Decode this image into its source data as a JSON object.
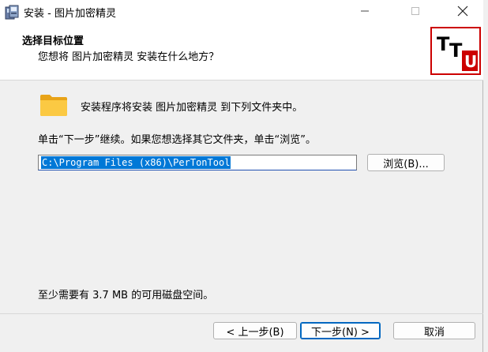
{
  "window": {
    "title": "安装 - 图片加密精灵",
    "min_glyph": "—",
    "max_glyph": "☐",
    "close_glyph": "✕"
  },
  "header": {
    "title": "选择目标位置",
    "subtitle": "您想将 图片加密精灵 安装在什么地方？",
    "logo_text": [
      "T",
      "T",
      "U"
    ]
  },
  "main": {
    "destination_label": "安装程序将安装 图片加密精灵 到下列文件夹中。",
    "instruction": "单击“下一步”继续。如果您想选择其它文件夹，单击“浏览”。",
    "path_value": "C:\\Program Files (x86)\\PerTonTool",
    "browse_label": "浏览(B)...",
    "space_required": "至少需要有 3.7 MB 的可用磁盘空间。"
  },
  "footer": {
    "back_label": "< 上一步(B)",
    "next_label": "下一步(N) >",
    "cancel_label": "取消"
  },
  "colors": {
    "selection": "#0078d7",
    "logo_red": "#cc0000",
    "default_button_border": "#0067c0"
  },
  "icons": [
    "installer-app-icon",
    "minimize-icon",
    "maximize-icon",
    "close-icon",
    "folder-icon",
    "ttu-logo"
  ]
}
